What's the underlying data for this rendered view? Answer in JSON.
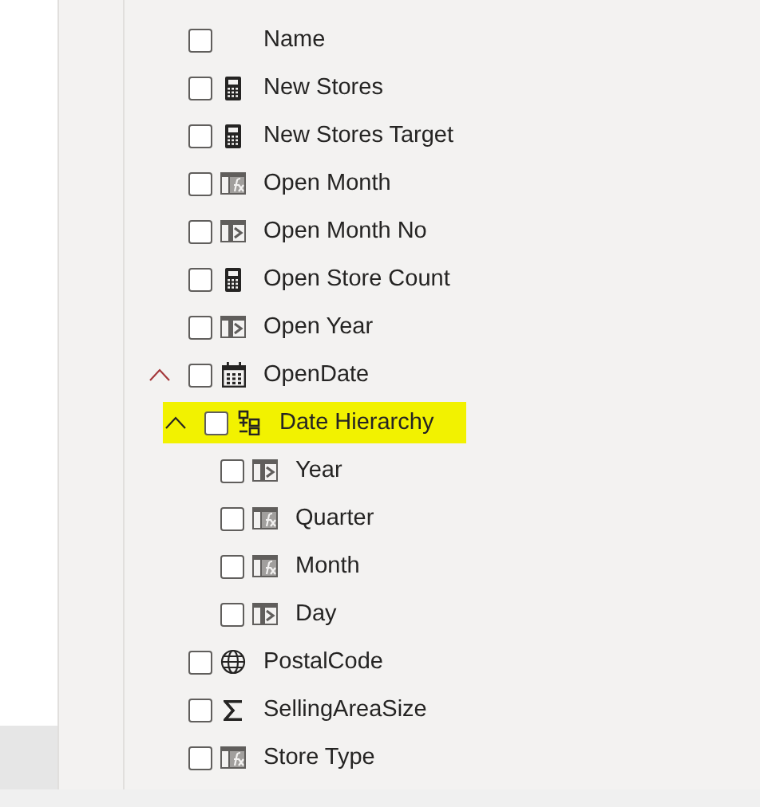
{
  "fields": [
    {
      "label": "Name",
      "kind": "text",
      "checked": false
    },
    {
      "label": "New Stores",
      "kind": "measure",
      "checked": false
    },
    {
      "label": "New Stores Target",
      "kind": "measure",
      "checked": false
    },
    {
      "label": "Open Month",
      "kind": "calculated",
      "checked": false
    },
    {
      "label": "Open Month No",
      "kind": "column",
      "checked": false
    },
    {
      "label": "Open Store Count",
      "kind": "measure",
      "checked": false
    },
    {
      "label": "Open Year",
      "kind": "column",
      "checked": false
    },
    {
      "label": "OpenDate",
      "kind": "date",
      "checked": false,
      "expanded": true,
      "children": [
        {
          "label": "Date Hierarchy",
          "kind": "hierarchy",
          "checked": false,
          "expanded": true,
          "highlighted": true,
          "children": [
            {
              "label": "Year",
              "kind": "column",
              "checked": false
            },
            {
              "label": "Quarter",
              "kind": "calculated",
              "checked": false
            },
            {
              "label": "Month",
              "kind": "calculated",
              "checked": false
            },
            {
              "label": "Day",
              "kind": "column",
              "checked": false
            }
          ]
        }
      ]
    },
    {
      "label": "PostalCode",
      "kind": "geo",
      "checked": false
    },
    {
      "label": "SellingAreaSize",
      "kind": "sum",
      "checked": false
    },
    {
      "label": "Store Type",
      "kind": "calculated",
      "checked": false
    }
  ]
}
